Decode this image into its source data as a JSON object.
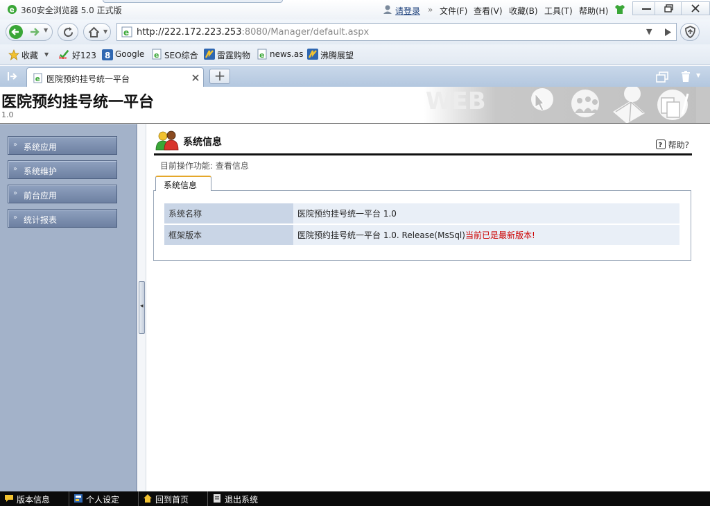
{
  "browser": {
    "title": "360安全浏览器 5.0 正式版",
    "login": "请登录",
    "menus": [
      "文件(F)",
      "查看(V)",
      "收藏(B)",
      "工具(T)",
      "帮助(H)"
    ],
    "address": {
      "host": "http://222.172.223.253",
      "rest": ":8080/Manager/default.aspx"
    },
    "bookmarks": [
      "收藏",
      "好123",
      "Google",
      "SEO综合",
      "雷霆购物",
      "news.as",
      "沸腾展望"
    ],
    "bookmark_hao_badge": "hao",
    "bookmark_google_badge": "8",
    "tab_title": "医院预约挂号统一平台",
    "colors": {
      "accent": "#2f67b1",
      "home_green": "#3aa637",
      "title_bg": "#ffffff"
    }
  },
  "page": {
    "title": "医院预约挂号统一平台",
    "version": "1.0"
  },
  "sidebar": {
    "items": [
      {
        "label": "系统应用"
      },
      {
        "label": "系统维护"
      },
      {
        "label": "前台应用"
      },
      {
        "label": "统计报表"
      }
    ]
  },
  "main": {
    "section_title": "系统信息",
    "help": "帮助?",
    "op_line": "目前操作功能: 查看信息",
    "tab": "系统信息",
    "rows": [
      {
        "key": "系统名称",
        "value": "医院预约挂号统一平台  1.0",
        "note": ""
      },
      {
        "key": "框架版本",
        "value": "医院预约挂号统一平台  1.0. Release(MsSql)",
        "note": "当前已是最新版本!"
      }
    ]
  },
  "statusbar": {
    "items": [
      "版本信息",
      "个人设定",
      "回到首页",
      "退出系统"
    ]
  }
}
